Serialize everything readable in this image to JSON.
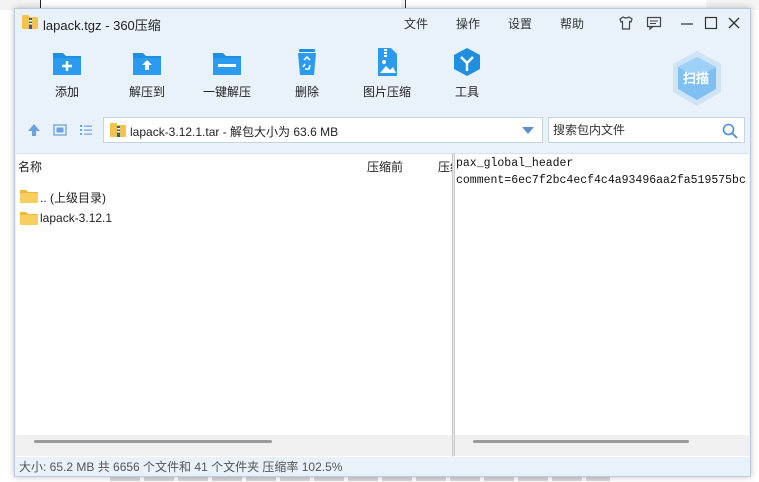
{
  "window": {
    "title": "lapack.tgz - 360压缩"
  },
  "menu": {
    "items": [
      "文件",
      "操作",
      "设置",
      "帮助"
    ]
  },
  "toolbar": {
    "add": "添加",
    "extract_to": "解压到",
    "one_click_extract": "一键解压",
    "delete": "删除",
    "image_compress": "图片压缩",
    "tools": "工具",
    "scan": "扫描"
  },
  "address": {
    "path": "lapack-3.12.1.tar - 解包大小为 63.6 MB",
    "search_placeholder": "搜索包内文件"
  },
  "columns": {
    "name": "名称",
    "size_before": "压缩前",
    "size_after": "压缩后"
  },
  "files": [
    {
      "name": ".. (上级目录)"
    },
    {
      "name": "lapack-3.12.1"
    }
  ],
  "preview": {
    "line1": "pax_global_header",
    "line2": "comment=6ec7f2bc4ecf4c4a93496aa2fa519575bc"
  },
  "status": "大小: 65.2 MB 共 6656 个文件和 41 个文件夹 压缩率 102.5%",
  "colors": {
    "accent": "#1f8fe0",
    "title_bg": "#e9f1fb",
    "folder": "#f4c24d"
  }
}
